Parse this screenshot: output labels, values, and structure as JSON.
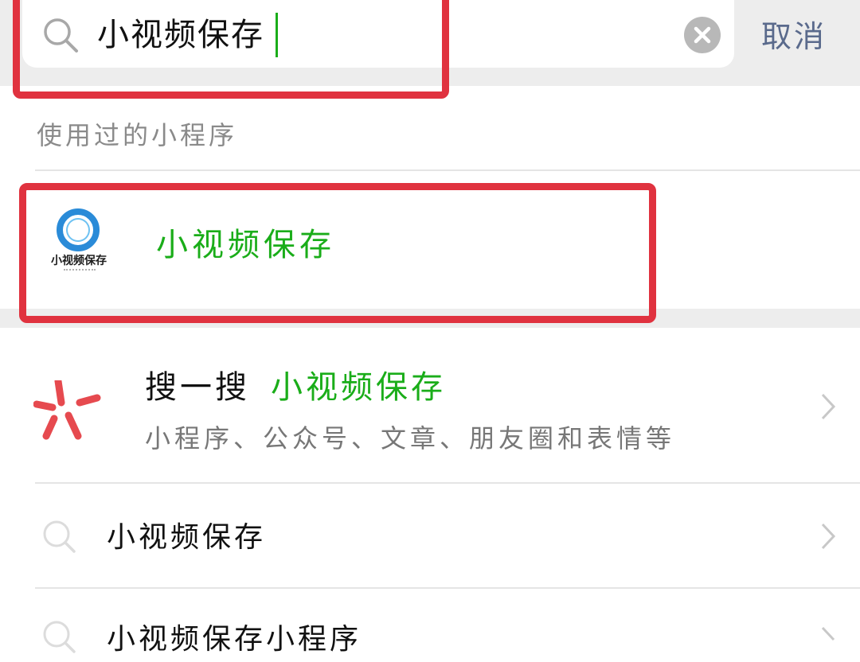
{
  "search": {
    "query": "小视频保存",
    "cancel_label": "取消"
  },
  "used_section": {
    "title": "使用过的小程序",
    "item": {
      "name": "小视频保存",
      "logo_text": "小视频保存"
    }
  },
  "sou_yi_sou": {
    "label": "搜一搜",
    "keyword": "小视频保存",
    "subtitle": "小程序、公众号、文章、朋友圈和表情等"
  },
  "suggestions": [
    {
      "text": "小视频保存"
    },
    {
      "text": "小视频保存小程序"
    }
  ],
  "colors": {
    "accent_green": "#1aad19",
    "highlight_red": "#e0323f",
    "cancel_blue": "#5a6a8c",
    "logo_blue": "#2a8bd8",
    "sou_red": "#e64a4f"
  },
  "icons": {
    "search": "search-icon",
    "clear": "clear-icon",
    "chevron": "chevron-right-icon",
    "sou": "sou-yi-sou-icon"
  }
}
